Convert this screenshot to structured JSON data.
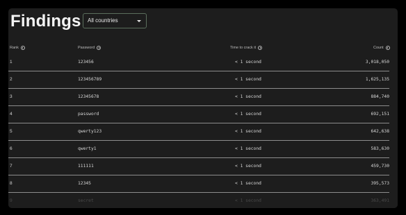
{
  "header": {
    "title": "Findings",
    "country_select": "All countries"
  },
  "table": {
    "columns": {
      "rank": "Rank",
      "password": "Password",
      "time": "Time to crack it",
      "count": "Count"
    },
    "rows": [
      {
        "rank": "1",
        "password": "123456",
        "time": "< 1 second",
        "count": "3,018,050"
      },
      {
        "rank": "2",
        "password": "123456789",
        "time": "< 1 second",
        "count": "1,625,135"
      },
      {
        "rank": "3",
        "password": "12345678",
        "time": "< 1 second",
        "count": "884,740"
      },
      {
        "rank": "4",
        "password": "password",
        "time": "< 1 second",
        "count": "692,151"
      },
      {
        "rank": "5",
        "password": "qwerty123",
        "time": "< 1 second",
        "count": "642,638"
      },
      {
        "rank": "6",
        "password": "qwerty1",
        "time": "< 1 second",
        "count": "583,630"
      },
      {
        "rank": "7",
        "password": "111111",
        "time": "< 1 second",
        "count": "459,730"
      },
      {
        "rank": "8",
        "password": "12345",
        "time": "< 1 second",
        "count": "395,573"
      },
      {
        "rank": "9",
        "password": "secret",
        "time": "< 1 second",
        "count": "363,491"
      }
    ]
  },
  "colors": {
    "background": "#1d1d1d",
    "text": "#d8d8d8",
    "separator": "#8d8d8d",
    "select_border": "#5b6e5d"
  },
  "icons": {
    "column_info": "info-icon",
    "select_arrow": "chevron-down-icon"
  }
}
